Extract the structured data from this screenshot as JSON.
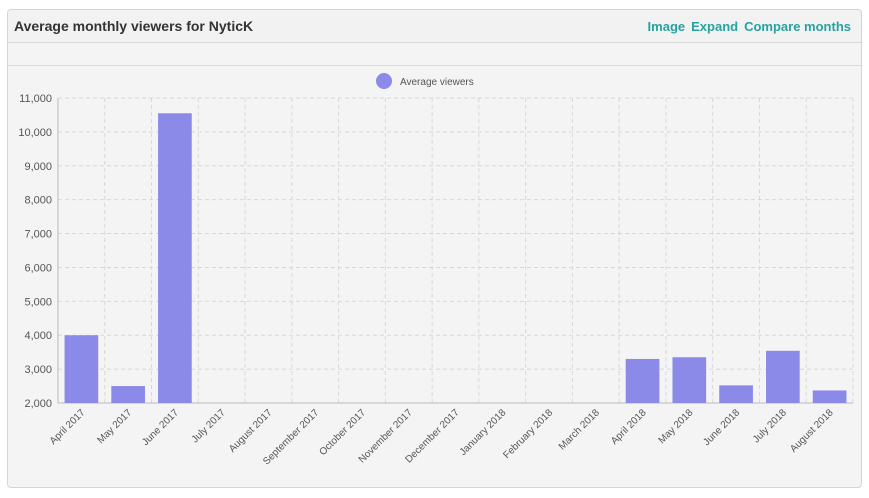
{
  "panel": {
    "title": "Average monthly viewers for NyticK",
    "actions": [
      "Image",
      "Expand",
      "Compare months"
    ]
  },
  "chart_data": {
    "type": "bar",
    "categories": [
      "April 2017",
      "May 2017",
      "June 2017",
      "July 2017",
      "August 2017",
      "September 2017",
      "October 2017",
      "November 2017",
      "December 2017",
      "January 2018",
      "February 2018",
      "March 2018",
      "April 2018",
      "May 2018",
      "June 2018",
      "July 2018",
      "August 2018"
    ],
    "series": [
      {
        "name": "Average viewers",
        "values": [
          4000,
          2500,
          10550,
          null,
          null,
          null,
          null,
          null,
          null,
          null,
          null,
          null,
          3300,
          3350,
          2520,
          3540,
          2370
        ],
        "color": "#8b8ae9"
      }
    ],
    "title": "",
    "xlabel": "",
    "ylabel": "",
    "ylim": [
      2000,
      11000
    ],
    "yticks": [
      "2,000",
      "3,000",
      "4,000",
      "5,000",
      "6,000",
      "7,000",
      "8,000",
      "9,000",
      "10,000",
      "11,000"
    ],
    "grid": true,
    "legend": "top-center"
  }
}
